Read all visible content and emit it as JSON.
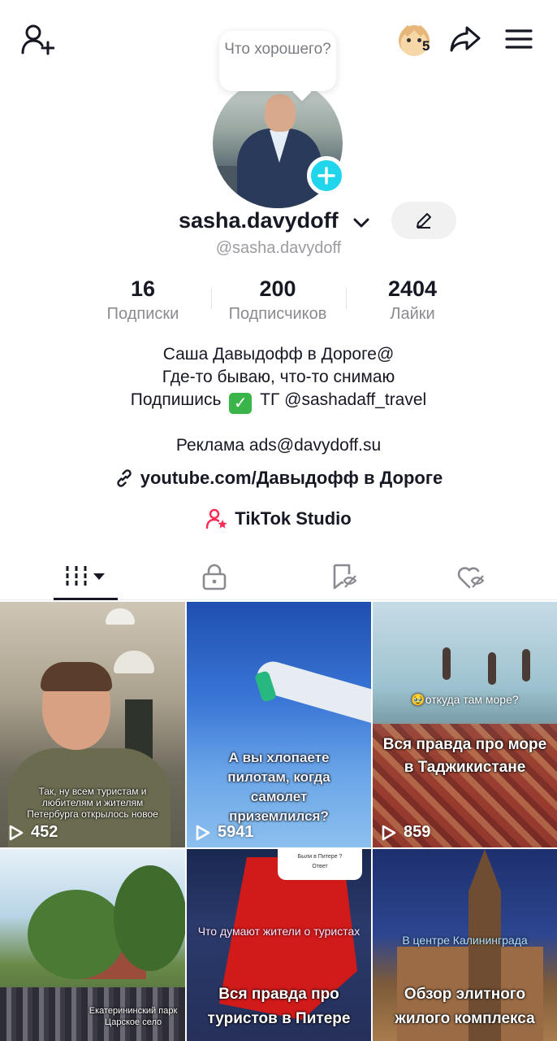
{
  "header": {
    "coins_count": "5",
    "colors": {
      "accent_cyan": "#20d5ec",
      "studio_pink": "#fe2c55",
      "text": "#161823",
      "muted": "#8a8b91"
    }
  },
  "profile": {
    "bubble_text": "Что хорошего?",
    "display_name": "sasha.davydoff",
    "handle": "@sasha.davydoff",
    "stats": [
      {
        "value": "16",
        "label": "Подписки"
      },
      {
        "value": "200",
        "label": "Подписчиков"
      },
      {
        "value": "2404",
        "label": "Лайки"
      }
    ],
    "bio_line1": "Саша Давыдофф в Дороге@",
    "bio_line2": "Где-то бываю, что-то снимаю",
    "bio_line3_prefix": "Подпишись",
    "bio_line3_suffix": "ТГ @sashadaff_travel",
    "ads": "Реклама ads@davydoff.su",
    "link": "youtube.com/Давыдофф в Дороге",
    "studio": "TikTok Studio"
  },
  "tabs": [
    {
      "name": "videos",
      "icon": "grid-icon",
      "active": true
    },
    {
      "name": "private",
      "icon": "lock-icon"
    },
    {
      "name": "saved",
      "icon": "bookmark-icon"
    },
    {
      "name": "liked",
      "icon": "heart-icon"
    }
  ],
  "videos": [
    {
      "caption": "Так, ну всем туристам и любителям и жителям Петербурга открылось новое",
      "views": "452"
    },
    {
      "caption": "А вы хлопаете пилотам, когда самолет приземлился?",
      "views": "5941"
    },
    {
      "caption_top": "🥹откуда там море?",
      "caption": "Вся правда про море в Таджикистане",
      "views": "859"
    },
    {
      "caption": "Екатерининский парк Царское село",
      "views": ""
    },
    {
      "popup_title": "Были в Питере ?",
      "popup_answer": "Ответ",
      "caption_top": "Что думают жители о туристах",
      "caption": "Вся правда про туристов в Питере",
      "views": ""
    },
    {
      "caption_top": "В центре Калининграда",
      "caption": "Обзор элитного жилого комплекса",
      "views": ""
    }
  ]
}
